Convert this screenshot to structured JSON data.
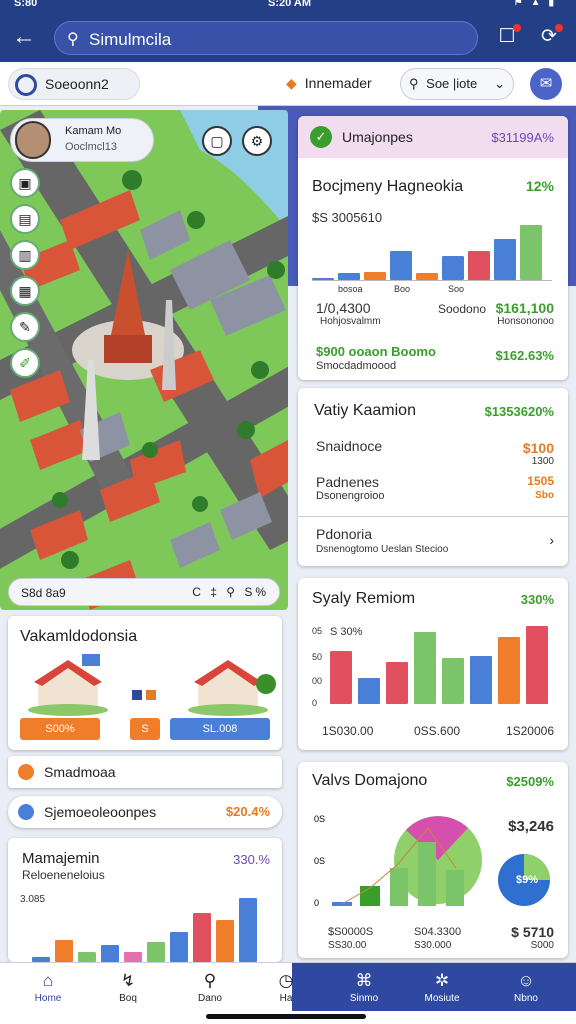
{
  "status": {
    "time_left": "S:80",
    "time_center": "S:20 AM"
  },
  "app": {
    "search_text": "Simulmcila"
  },
  "subbar": {
    "left_chip": "Soeoonn2",
    "mid_chip": "Innemader",
    "sort": "Soe |iote"
  },
  "map": {
    "user_name": "Kamam Mo",
    "user_sub": "Ooclmcl13",
    "footer_left": "S8d 8a9",
    "footer_right": "C ‡ ⚲ S%"
  },
  "left_card1": {
    "title": "Vakamldodonsia",
    "btn1": "S00%",
    "btn2": "S",
    "btn3": "SL.008"
  },
  "left_list": {
    "item1": "Smadmoaa",
    "item2": "Sjemoeoleoonpes",
    "item2_value": "$20.4%"
  },
  "left_card2": {
    "title": "Mamajemin",
    "sub": "Reloeneneloius",
    "value": "330.%",
    "ytick": "3.085"
  },
  "card_a": {
    "title": "Umajonpes",
    "title_value": "$31199A%",
    "subtitle": "Bocjmeny Hagneokia",
    "subtitle_value": "12%",
    "amount": "$S 3005610",
    "tick1": "bosoa",
    "tick2": "Boo",
    "tick3": "Soo",
    "left_value": "1/0,4300",
    "left_sub": "Hohjosvalmm",
    "mid_label": "Soodono",
    "right_value": "$161,100",
    "right_sub": "Honsononoo",
    "row_value": "$900 ooaon Boomo",
    "row_sub": "Smocdadmoood",
    "row_right": "$162.63%"
  },
  "card_b": {
    "title": "Vatiy Kaamion",
    "title_value": "$1353620%",
    "row1": "Snaidnoce",
    "row1_value": "$100",
    "row1_sub": "1300",
    "row2": "Padnenes",
    "row2_sub": "Dsonengroioo",
    "row2_value": "1505",
    "row2_value2": "Sbo",
    "link_title": "Pdonoria",
    "link_sub": "Dsnenogtomo Ueslan Stecioo"
  },
  "card_c": {
    "title": "Syaly Remiom",
    "title_value": "330%",
    "yticks": [
      "05",
      "50",
      "00",
      "0"
    ],
    "y_label_top": "S 30%",
    "bottom_left": "1S030.00",
    "bottom_mid": "0SS.600",
    "bottom_right": "1S20006"
  },
  "card_d": {
    "title": "Valvs Domajono",
    "title_value": "$2509%",
    "side_value": "$3,246",
    "donut_label": "$9%",
    "bottom_left": "$S0000S",
    "bottom_left_sub": "SS30.00",
    "bottom_mid": "S04.3300",
    "bottom_mid_sub": "S30.000",
    "bottom_right": "$ 5710",
    "bottom_right_sub": "S000"
  },
  "bottom_nav": [
    "Home",
    "Boq",
    "Dano",
    "Ha",
    "Sinmo",
    "Mosiute",
    "Nbno"
  ],
  "colors": {
    "primary": "#233f86",
    "green": "#3a9e2c",
    "orange": "#e57b22",
    "red": "#e0505e",
    "blue": "#4a7fd8"
  },
  "chart_data": [
    {
      "type": "bar",
      "values": [
        2,
        6,
        7,
        24,
        6,
        20,
        24,
        34,
        46
      ]
    },
    {
      "type": "bar",
      "values": [
        55,
        27,
        44,
        75,
        48,
        50,
        70,
        82
      ]
    },
    {
      "type": "bar",
      "values": [
        2,
        9,
        4,
        7,
        4,
        8,
        12,
        20,
        17,
        26
      ]
    }
  ]
}
